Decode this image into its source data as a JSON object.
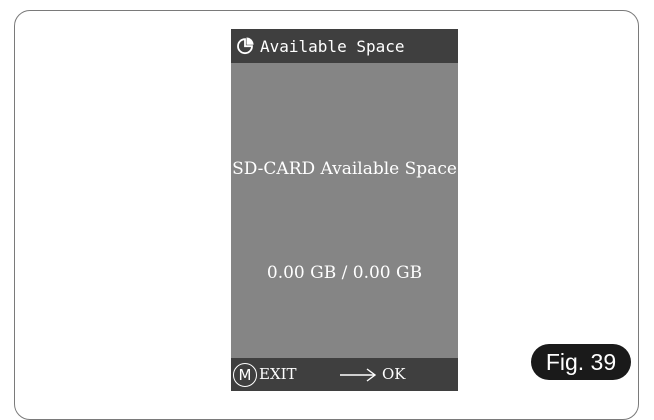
{
  "screen": {
    "title": "Available Space",
    "title_icon": "pie-chart-icon",
    "heading": "SD-CARD Available Space",
    "used": "0.00 GB",
    "separator": "/",
    "total": "0.00 GB"
  },
  "footer": {
    "menu_key": "M",
    "menu_icon": "circled-m-icon",
    "exit_label": "EXIT",
    "arrow_icon": "right-arrow-icon",
    "ok_label": "OK"
  },
  "figure_label": "Fig. 39",
  "colors": {
    "screen_bg": "#858585",
    "bar_bg": "#3f3f3f",
    "text": "#ffffff",
    "badge_bg": "#1a1a1a"
  }
}
